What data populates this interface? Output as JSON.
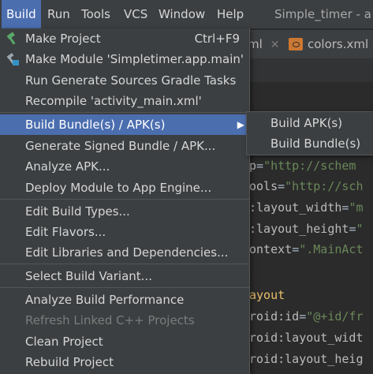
{
  "menubar": {
    "items": [
      "Build",
      "Run",
      "Tools",
      "VCS",
      "Window",
      "Help"
    ],
    "title": "Simple_timer - a"
  },
  "tabs": [
    {
      "label": "ml"
    },
    {
      "label": "colors.xml"
    }
  ],
  "code_lines": [
    {
      "a": "p",
      "eq": "=",
      "s": "\"http://schem"
    },
    {
      "a": "ools",
      "eq": "=",
      "s": "\"http://sch"
    },
    {
      "a": ":layout_width",
      "eq": "=",
      "s": "\"m"
    },
    {
      "a": ":layout_height",
      "eq": "=",
      "s": "\""
    },
    {
      "a": "ontext",
      "eq": "=",
      "s": "\".MainAct"
    },
    {
      "a": "",
      "eq": "",
      "s": ""
    },
    {
      "a": "ayout",
      "eq": "",
      "s": ""
    },
    {
      "a": "roid:id",
      "eq": "=",
      "s": "\"@+id/fr"
    },
    {
      "a": "roid:layout_widt",
      "eq": "",
      "s": ""
    },
    {
      "a": "roid:layout_heig",
      "eq": "",
      "s": ""
    }
  ],
  "menu": {
    "items": [
      {
        "label": "Make Project",
        "shortcut": "Ctrl+F9",
        "icon": "hammer-icon"
      },
      {
        "label": "Make Module 'Simpletimer.app.main'",
        "shortcut": "",
        "icon": "make-module-icon"
      },
      {
        "label": "Run Generate Sources Gradle Tasks",
        "shortcut": ""
      },
      {
        "label": "Recompile 'activity_main.xml'",
        "shortcut": ""
      },
      {
        "label": "Build Bundle(s) / APK(s)",
        "shortcut": "",
        "submenu": true,
        "selected": true
      },
      {
        "label": "Generate Signed Bundle / APK...",
        "shortcut": ""
      },
      {
        "label": "Analyze APK...",
        "shortcut": ""
      },
      {
        "label": "Deploy Module to App Engine...",
        "shortcut": ""
      },
      {
        "label": "Edit Build Types...",
        "shortcut": ""
      },
      {
        "label": "Edit Flavors...",
        "shortcut": ""
      },
      {
        "label": "Edit Libraries and Dependencies...",
        "shortcut": ""
      },
      {
        "label": "Select Build Variant...",
        "shortcut": ""
      },
      {
        "label": "Analyze Build Performance",
        "shortcut": ""
      },
      {
        "label": "Refresh Linked C++ Projects",
        "shortcut": "",
        "disabled": true
      },
      {
        "label": "Clean Project",
        "shortcut": ""
      },
      {
        "label": "Rebuild Project",
        "shortcut": ""
      }
    ]
  },
  "submenu": {
    "items": [
      "Build APK(s)",
      "Build Bundle(s)"
    ]
  }
}
